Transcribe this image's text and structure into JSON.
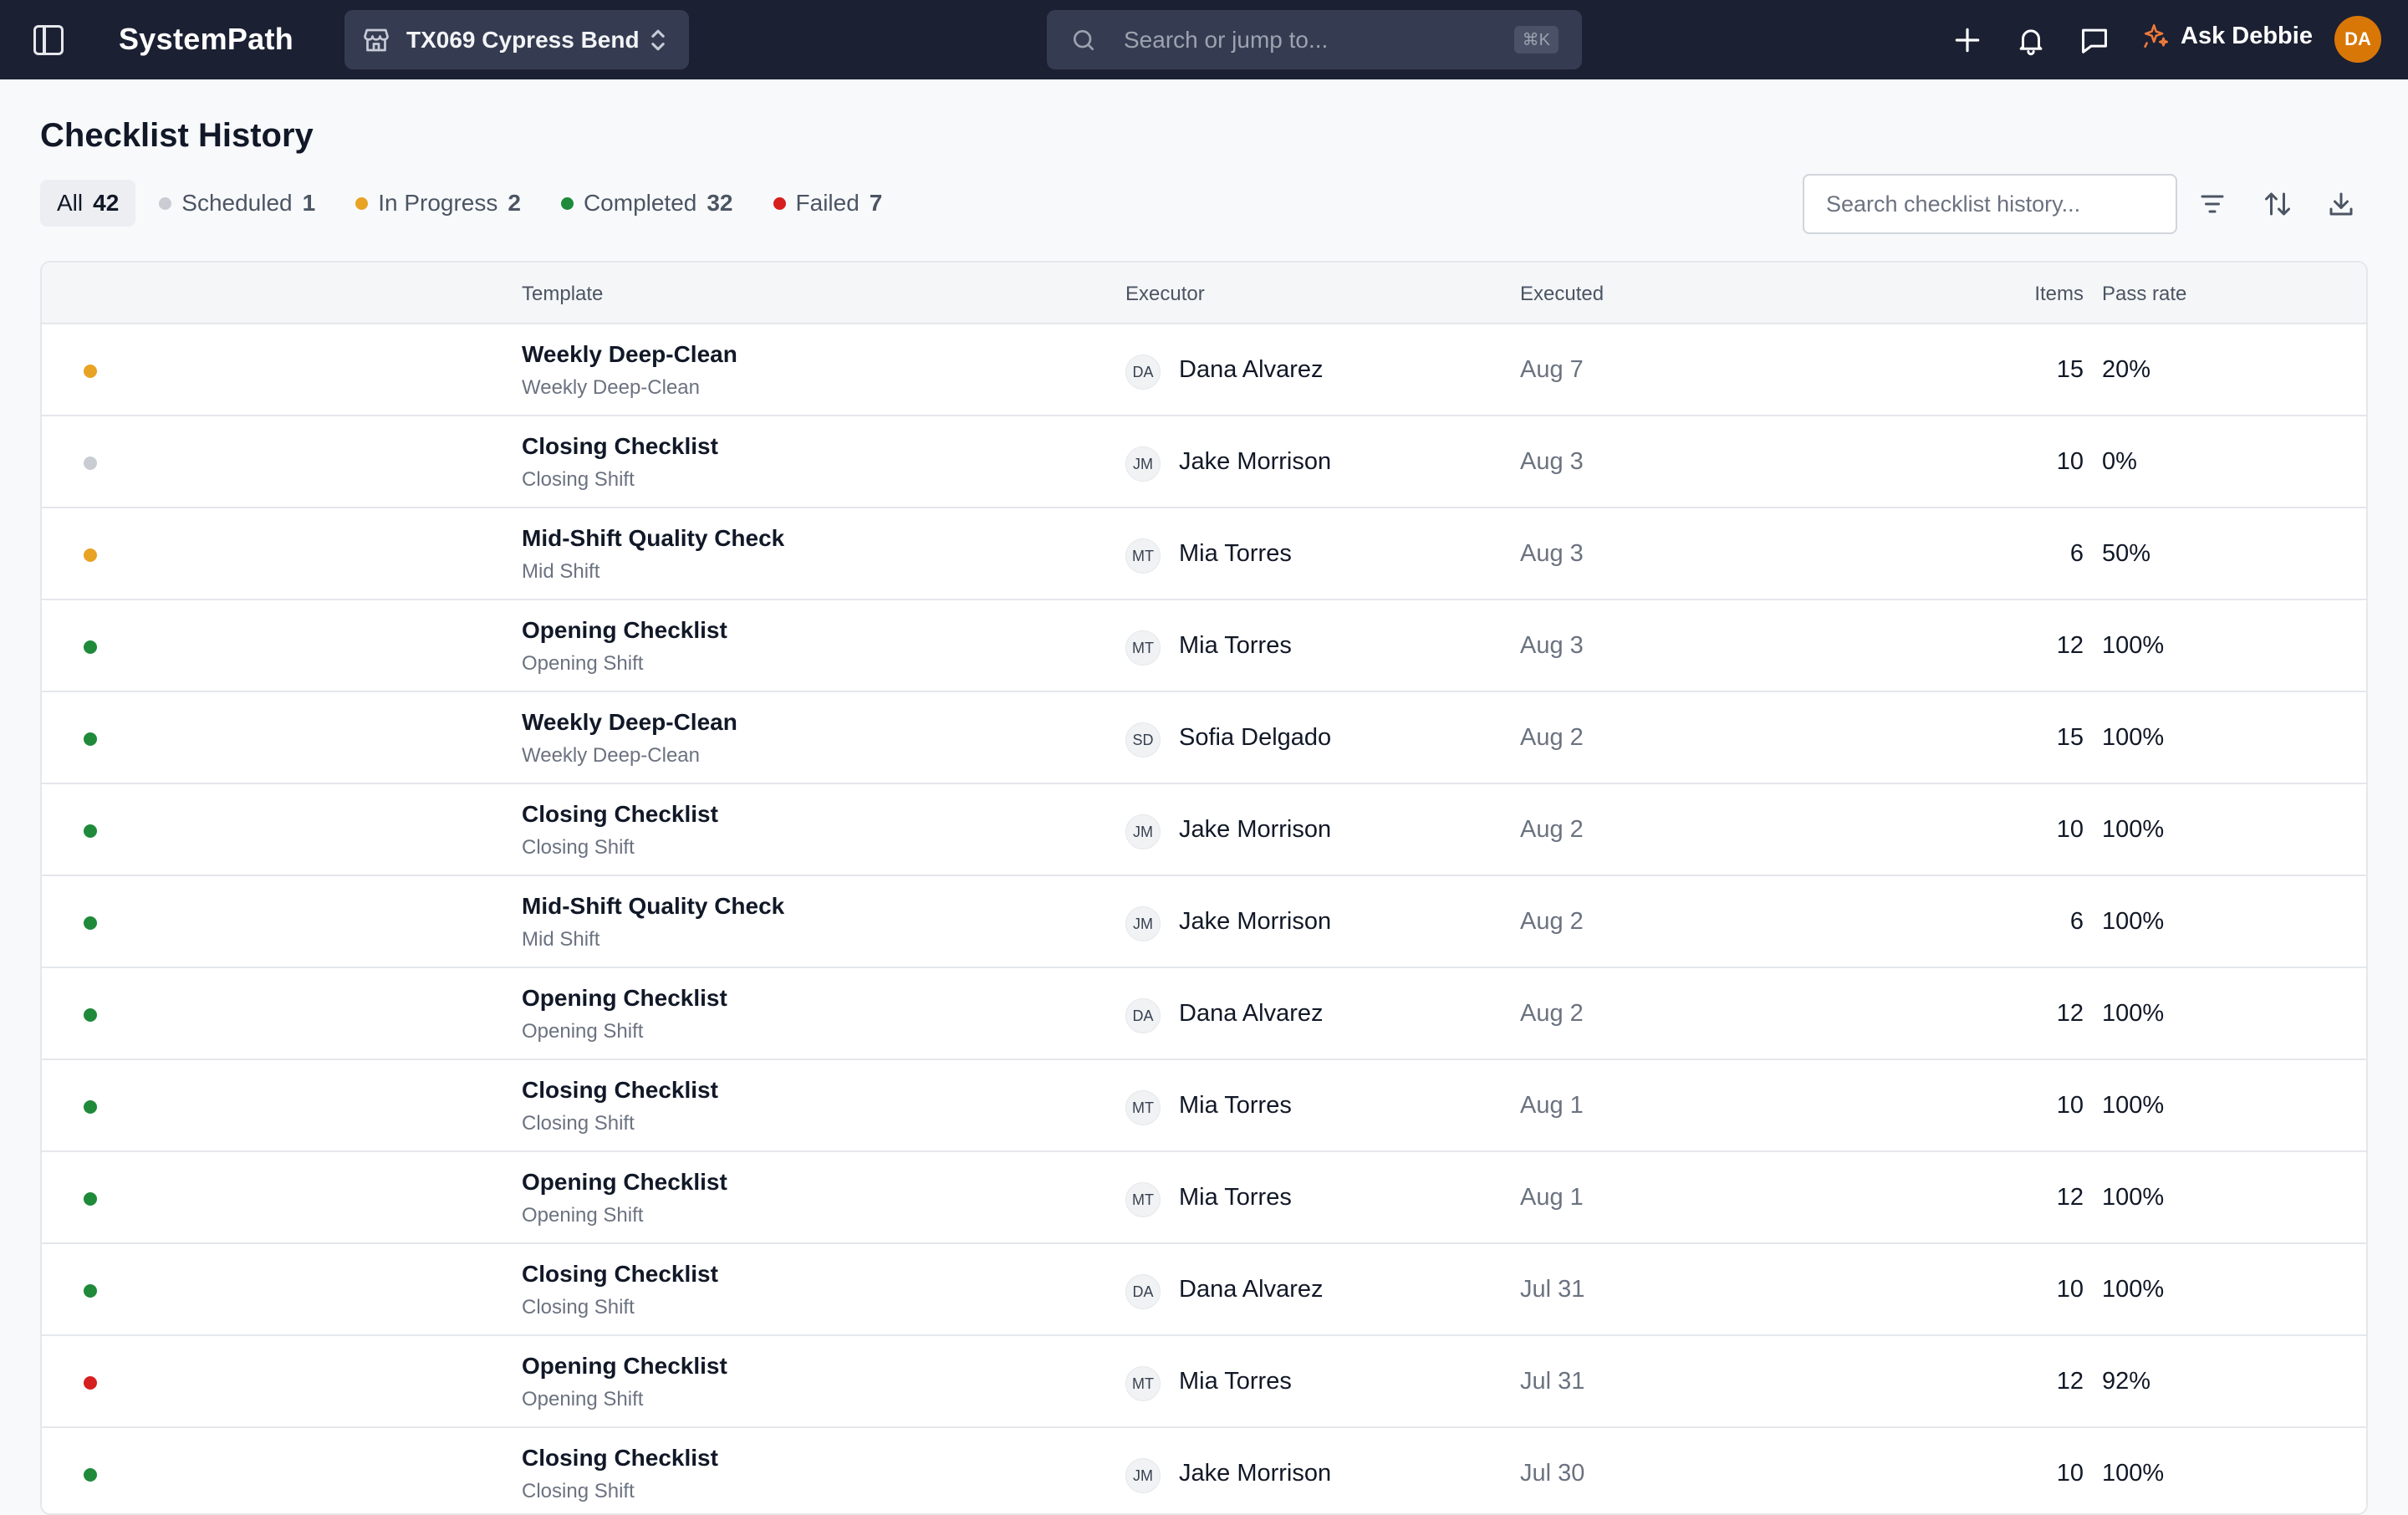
{
  "app": {
    "brand": "SystemPath",
    "store": "TX069 Cypress Bend",
    "search_placeholder": "Search or jump to...",
    "search_shortcut": "⌘K",
    "ask_label": "Ask Debbie",
    "user_initials": "DA"
  },
  "page": {
    "title": "Checklist History",
    "history_search_placeholder": "Search checklist history..."
  },
  "filters": [
    {
      "label": "All",
      "count": "42",
      "dot": ""
    },
    {
      "label": "Scheduled",
      "count": "1",
      "dot": "#c9ccd2"
    },
    {
      "label": "In Progress",
      "count": "2",
      "dot": "#e8a324"
    },
    {
      "label": "Completed",
      "count": "32",
      "dot": "#1f8a3a"
    },
    {
      "label": "Failed",
      "count": "7",
      "dot": "#d61f1f"
    }
  ],
  "columns": {
    "template": "Template",
    "executor": "Executor",
    "executed": "Executed",
    "items": "Items",
    "pass_rate": "Pass rate"
  },
  "status_colors": {
    "scheduled": "#c9ccd2",
    "in_progress": "#e8a324",
    "completed": "#1f8a3a",
    "failed": "#d61f1f"
  },
  "rows": [
    {
      "status": "in_progress",
      "template": "Weekly Deep-Clean",
      "sub": "Weekly Deep-Clean",
      "initials": "DA",
      "executor": "Dana Alvarez",
      "executed": "Aug 7",
      "items": "15",
      "pass_rate": "20%"
    },
    {
      "status": "scheduled",
      "template": "Closing Checklist",
      "sub": "Closing Shift",
      "initials": "JM",
      "executor": "Jake Morrison",
      "executed": "Aug 3",
      "items": "10",
      "pass_rate": "0%"
    },
    {
      "status": "in_progress",
      "template": "Mid-Shift Quality Check",
      "sub": "Mid Shift",
      "initials": "MT",
      "executor": "Mia Torres",
      "executed": "Aug 3",
      "items": "6",
      "pass_rate": "50%"
    },
    {
      "status": "completed",
      "template": "Opening Checklist",
      "sub": "Opening Shift",
      "initials": "MT",
      "executor": "Mia Torres",
      "executed": "Aug 3",
      "items": "12",
      "pass_rate": "100%"
    },
    {
      "status": "completed",
      "template": "Weekly Deep-Clean",
      "sub": "Weekly Deep-Clean",
      "initials": "SD",
      "executor": "Sofia Delgado",
      "executed": "Aug 2",
      "items": "15",
      "pass_rate": "100%"
    },
    {
      "status": "completed",
      "template": "Closing Checklist",
      "sub": "Closing Shift",
      "initials": "JM",
      "executor": "Jake Morrison",
      "executed": "Aug 2",
      "items": "10",
      "pass_rate": "100%"
    },
    {
      "status": "completed",
      "template": "Mid-Shift Quality Check",
      "sub": "Mid Shift",
      "initials": "JM",
      "executor": "Jake Morrison",
      "executed": "Aug 2",
      "items": "6",
      "pass_rate": "100%"
    },
    {
      "status": "completed",
      "template": "Opening Checklist",
      "sub": "Opening Shift",
      "initials": "DA",
      "executor": "Dana Alvarez",
      "executed": "Aug 2",
      "items": "12",
      "pass_rate": "100%"
    },
    {
      "status": "completed",
      "template": "Closing Checklist",
      "sub": "Closing Shift",
      "initials": "MT",
      "executor": "Mia Torres",
      "executed": "Aug 1",
      "items": "10",
      "pass_rate": "100%"
    },
    {
      "status": "completed",
      "template": "Opening Checklist",
      "sub": "Opening Shift",
      "initials": "MT",
      "executor": "Mia Torres",
      "executed": "Aug 1",
      "items": "12",
      "pass_rate": "100%"
    },
    {
      "status": "completed",
      "template": "Closing Checklist",
      "sub": "Closing Shift",
      "initials": "DA",
      "executor": "Dana Alvarez",
      "executed": "Jul 31",
      "items": "10",
      "pass_rate": "100%"
    },
    {
      "status": "failed",
      "template": "Opening Checklist",
      "sub": "Opening Shift",
      "initials": "MT",
      "executor": "Mia Torres",
      "executed": "Jul 31",
      "items": "12",
      "pass_rate": "92%"
    },
    {
      "status": "completed",
      "template": "Closing Checklist",
      "sub": "Closing Shift",
      "initials": "JM",
      "executor": "Jake Morrison",
      "executed": "Jul 30",
      "items": "10",
      "pass_rate": "100%"
    }
  ]
}
